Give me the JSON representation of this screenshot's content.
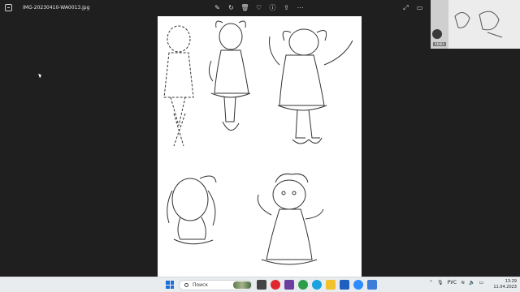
{
  "viewer": {
    "file_name": "IMG-20230410-WA0013.jpg",
    "toolbar_icons": [
      "edit-icon",
      "rotate-icon",
      "delete-icon",
      "favorite-icon",
      "info-icon",
      "share-icon",
      "more-icon"
    ],
    "window_icons": [
      "fullscreen-icon",
      "slideshow-icon",
      "close-icon"
    ]
  },
  "webcam": {
    "label": "KNIKA"
  },
  "taskbar": {
    "search_placeholder": "Поиск",
    "apps": [
      {
        "name": "task-view",
        "color": "#444444"
      },
      {
        "name": "opera",
        "color": "#e0282e"
      },
      {
        "name": "pdf",
        "color": "#6b3fa0"
      },
      {
        "name": "chrome",
        "color": "#2e9d4a"
      },
      {
        "name": "skype",
        "color": "#1aa1e0"
      },
      {
        "name": "explorer",
        "color": "#f2c12e"
      },
      {
        "name": "app-blue",
        "color": "#1f5fbf"
      },
      {
        "name": "zoom",
        "color": "#2d8cff"
      },
      {
        "name": "photos",
        "color": "#3b7dd8"
      }
    ],
    "language": "РУС",
    "time": "13:29",
    "date": "11.04.2023"
  }
}
